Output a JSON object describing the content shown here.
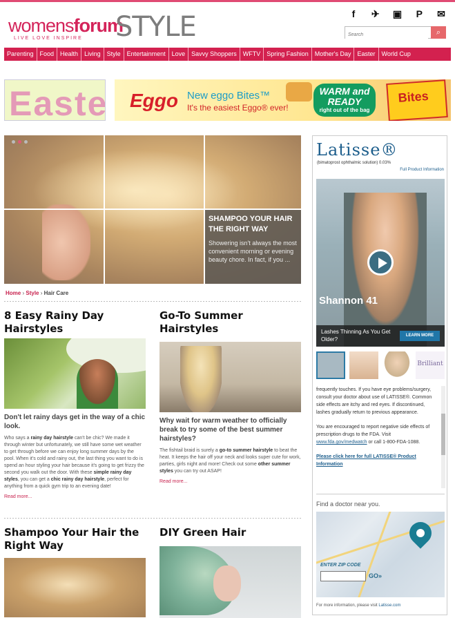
{
  "header": {
    "logo_women": "womens",
    "logo_forum": "forum",
    "logo_style": "STYLE",
    "logo_tagline": "LIVE LOVE INSPIRE",
    "social": [
      {
        "icon": "facebook-icon",
        "glyph": "f"
      },
      {
        "icon": "twitter-icon",
        "glyph": "✈"
      },
      {
        "icon": "instagram-icon",
        "glyph": "▣"
      },
      {
        "icon": "pinterest-icon",
        "glyph": "P"
      },
      {
        "icon": "email-icon",
        "glyph": "✉"
      }
    ],
    "search_placeholder": "Search",
    "search_button_icon": "⌕"
  },
  "nav": [
    "Parenting",
    "Food",
    "Health",
    "Living",
    "Style",
    "Entertainment",
    "Love",
    "Savvy Shoppers",
    "WFTV",
    "Spring Fashion",
    "Mother's Day",
    "Easter",
    "World Cup"
  ],
  "ads": {
    "easter_text": "Easter",
    "eggo_brand": "Eggo",
    "eggo_headline": "New eggo Bites™",
    "eggo_subline": "It's the easiest Eggo® ever!",
    "eggo_badge_big": "WARM and READY",
    "eggo_badge_small": "right out of the bag",
    "eggo_box_text": "Bites"
  },
  "hero": {
    "title": "SHAMPOO YOUR HAIR THE RIGHT WAY",
    "text": "Showering isn't always the most convenient morning or evening beauty chore. In fact, if you ..."
  },
  "breadcrumb": {
    "home": "Home",
    "sep": "›",
    "style": "Style",
    "current": "Hair Care"
  },
  "articles": [
    {
      "title": "8 Easy Rainy Day Hairstyles",
      "deck": "Don't let rainy days get in the way of a chic look.",
      "body_1": "Who says a ",
      "body_b1": "rainy day hairstyle",
      "body_2": " can't be chic? We made it through winter but unfortunately, we still have some wet weather to get through before we can enjoy long summer days by the pool. When it's cold and rainy out, the last thing you want to do is spend an hour styling your hair because it's going to get frizzy the second you walk out the door. With these ",
      "body_b2": "simple rainy day styles",
      "body_3": ", you can get a ",
      "body_b3": "chic rainy day hairstyle",
      "body_4": ", perfect for anything from a quick gym trip to an evening date!",
      "more": "Read more..."
    },
    {
      "title": "Go-To Summer Hairstyles",
      "deck": "Why wait for warm weather to officially break to try some of the best summer hairstyles?",
      "body_1": "The fishtail braid is surely a ",
      "body_b1": "go-to summer hairstyle",
      "body_2": " to beat the heat. It keeps the hair off your neck and looks super cute for work, parties, girls night and more! Check out some ",
      "body_b2": "other summer styles",
      "body_3": " you can try out ASAP!",
      "more": "Read more..."
    },
    {
      "title": "Shampoo Your Hair the Right Way"
    },
    {
      "title": "DIY Green Hair"
    }
  ],
  "sidebar": {
    "brand": "Latisse®",
    "brand_sub": "(bimatoprost ophthalmic solution) 0.03%",
    "full_info": "Full Product Information",
    "video_name": "Shannon 41",
    "lashes_text": "Lashes Thinning As You Get Older?",
    "learn_more": "LEARN MORE",
    "thumb_brilliant": "Brilliant",
    "isi_p1": "frequently touches. If you have eye problems/surgery, consult your doctor about use of LATISSE®. Common side effects are itchy and red eyes. If discontinued, lashes gradually return to previous appearance.",
    "isi_p2_a": "You are encouraged to report negative side effects of prescription drugs to the FDA. Visit ",
    "isi_p2_link": "www.fda.gov/medwatch",
    "isi_p2_b": " or call 1-800-FDA-1088.",
    "isi_p3": "Please click here for full LATISSE® Product Information",
    "find_doctor": "Find a doctor near you.",
    "zip_label": "ENTER ZIP CODE",
    "go_label": "GO»",
    "more_info_a": "For more information, please visit ",
    "more_info_link": "Latisse.com"
  },
  "colors": {
    "brand_pink": "#d3214f",
    "link_blue": "#1d5e8c"
  }
}
